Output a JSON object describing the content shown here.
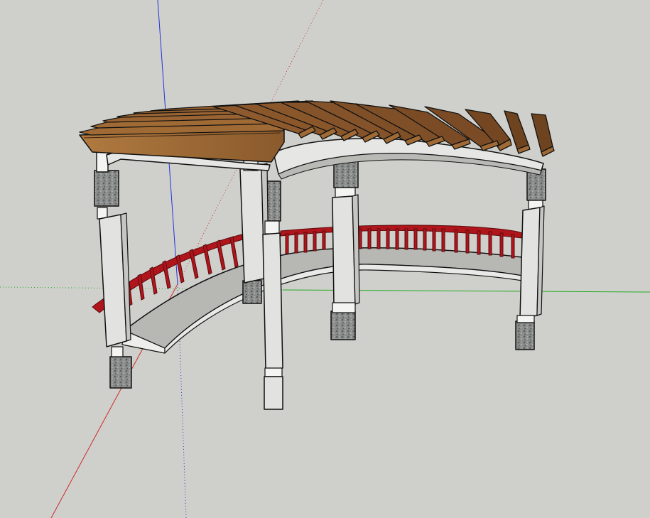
{
  "viewport": {
    "background": "#cfd0cb",
    "axes": {
      "red": "#cc2a2a",
      "green": "#22aa22",
      "blue": "#2233dd"
    }
  },
  "model": {
    "name": "",
    "colors": {
      "rafter_light": "#a06a35",
      "rafter_dark": "#6e4320",
      "beam": "#e6e6e4",
      "beam_shade": "#b9bab6",
      "column": "#e2e3e0",
      "column_shade": "#c6c7c3",
      "stone": "#7e8180",
      "railing": "#b0151c",
      "floor": "#b7b8b4",
      "edge": "#111111"
    }
  }
}
